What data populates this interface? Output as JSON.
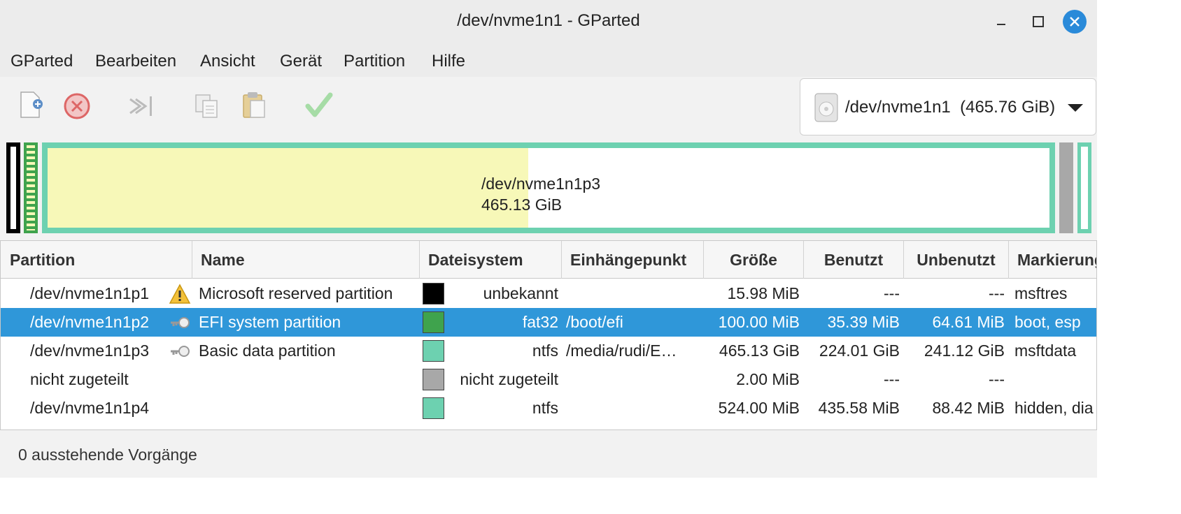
{
  "window": {
    "title": "/dev/nvme1n1 - GParted"
  },
  "menu": [
    "GParted",
    "Bearbeiten",
    "Ansicht",
    "Gerät",
    "Partition",
    "Hilfe"
  ],
  "toolbar": {
    "icons": [
      "new-partition-icon",
      "delete-icon",
      "resize-move-icon",
      "copy-icon",
      "paste-icon",
      "apply-icon"
    ]
  },
  "device": {
    "path": "/dev/nvme1n1",
    "size": "(465.76 GiB)"
  },
  "diskmap": {
    "main_label": "/dev/nvme1n1p3",
    "main_size": "465.13 GiB",
    "used_fraction": 0.48
  },
  "columns": [
    "Partition",
    "Name",
    "Dateisystem",
    "Einhängepunkt",
    "Größe",
    "Benutzt",
    "Unbenutzt",
    "Markierungen"
  ],
  "rows": [
    {
      "partition": "/dev/nvme1n1p1",
      "flag_icon": "warning-icon",
      "name": "Microsoft reserved partition",
      "color": "#000000",
      "fs": "unbekannt",
      "mount": "",
      "size": "15.98 MiB",
      "used": "---",
      "unused": "---",
      "flags": "msftres"
    },
    {
      "partition": "/dev/nvme1n1p2",
      "flag_icon": "key-icon",
      "name": "EFI system partition",
      "color": "#3fa34d",
      "fs": "fat32",
      "mount": "/boot/efi",
      "size": "100.00 MiB",
      "used": "35.39 MiB",
      "unused": "64.61 MiB",
      "flags": "boot, esp"
    },
    {
      "partition": "/dev/nvme1n1p3",
      "flag_icon": "key-icon",
      "name": "Basic data partition",
      "color": "#6dd1b0",
      "fs": "ntfs",
      "mount": "/media/rudi/E…",
      "size": "465.13 GiB",
      "used": "224.01 GiB",
      "unused": "241.12 GiB",
      "flags": "msftdata"
    },
    {
      "partition": "nicht zugeteilt",
      "flag_icon": "",
      "name": "",
      "color": "#a8a8a8",
      "fs": "nicht zugeteilt",
      "mount": "",
      "size": "2.00 MiB",
      "used": "---",
      "unused": "---",
      "flags": ""
    },
    {
      "partition": "/dev/nvme1n1p4",
      "flag_icon": "",
      "name": "",
      "color": "#6dd1b0",
      "fs": "ntfs",
      "mount": "",
      "size": "524.00 MiB",
      "used": "435.58 MiB",
      "unused": "88.42 MiB",
      "flags": "hidden, dia"
    }
  ],
  "status": {
    "pending": "0 ausstehende Vorgänge"
  },
  "colors": {
    "selection": "#2f97d9",
    "ntfs": "#6dd1b0",
    "fat32": "#3fa34d",
    "used_fill": "#f7f8b8",
    "unallocated": "#a8a8a8"
  }
}
